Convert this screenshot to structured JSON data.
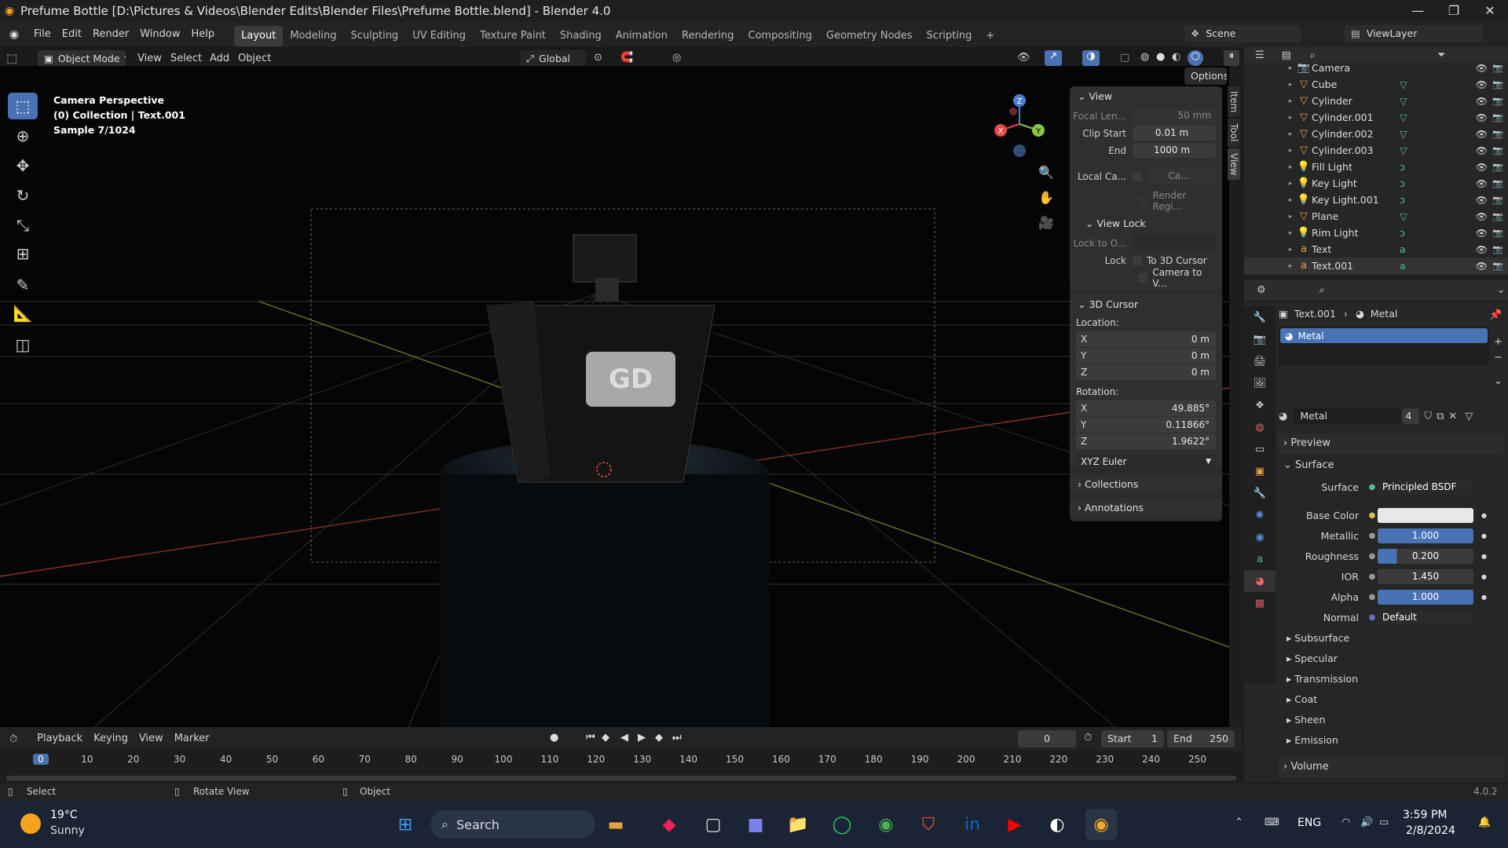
{
  "window": {
    "title": "Prefume Bottle [D:\\Pictures & Videos\\Blender Edits\\Blender Files\\Prefume Bottle.blend] - Blender 4.0",
    "minimize": "—",
    "maximize": "❐",
    "close": "✕"
  },
  "menubar": {
    "items": [
      "File",
      "Edit",
      "Render",
      "Window",
      "Help"
    ],
    "workspaces": [
      "Layout",
      "Modeling",
      "Sculpting",
      "UV Editing",
      "Texture Paint",
      "Shading",
      "Animation",
      "Rendering",
      "Compositing",
      "Geometry Nodes",
      "Scripting"
    ],
    "active_workspace": "Layout",
    "add_workspace": "+",
    "scene": "Scene",
    "view_layer": "ViewLayer"
  },
  "viewport_header": {
    "mode": "Object Mode",
    "menus": [
      "View",
      "Select",
      "Add",
      "Object"
    ],
    "orientation": "Global",
    "options": "Options"
  },
  "viewport": {
    "info_line1": "Camera Perspective",
    "info_line2": "(0) Collection | Text.001",
    "info_line3": "Sample 7/1024",
    "gizmo": {
      "x": "X",
      "y": "Y",
      "z": "Z"
    }
  },
  "npanel": {
    "tabs": [
      "Item",
      "Tool",
      "View"
    ],
    "view": {
      "title": "View",
      "focal_label": "Focal Len...",
      "focal_value": "50 mm",
      "clip_start_label": "Clip Start",
      "clip_start_value": "0.01 m",
      "end_label": "End",
      "end_value": "1000 m",
      "local_camera_label": "Local Ca...",
      "local_camera_value": "Ca...",
      "render_region": "Render Regi..."
    },
    "view_lock": {
      "title": "View Lock",
      "lock_to_label": "Lock to O...",
      "lock_label": "Lock",
      "to_3d_cursor": "To 3D Cursor",
      "camera_to_view": "Camera to V..."
    },
    "cursor": {
      "title": "3D Cursor",
      "location_label": "Location:",
      "loc_x": "0 m",
      "loc_y": "0 m",
      "loc_z": "0 m",
      "rotation_label": "Rotation:",
      "rot_x": "49.885°",
      "rot_y": "0.11866°",
      "rot_z": "1.9622°",
      "rotation_mode": "XYZ Euler"
    },
    "collections": "Collections",
    "annotations": "Annotations"
  },
  "outliner": {
    "items": [
      {
        "name": "Camera",
        "icon": "camera-icon"
      },
      {
        "name": "Cube",
        "icon": "mesh-icon"
      },
      {
        "name": "Cylinder",
        "icon": "mesh-icon"
      },
      {
        "name": "Cylinder.001",
        "icon": "mesh-icon"
      },
      {
        "name": "Cylinder.002",
        "icon": "mesh-icon"
      },
      {
        "name": "Cylinder.003",
        "icon": "mesh-icon"
      },
      {
        "name": "Fill Light",
        "icon": "light-icon"
      },
      {
        "name": "Key Light",
        "icon": "light-icon"
      },
      {
        "name": "Key Light.001",
        "icon": "light-icon"
      },
      {
        "name": "Plane",
        "icon": "mesh-icon"
      },
      {
        "name": "Rim Light",
        "icon": "light-icon"
      },
      {
        "name": "Text",
        "icon": "text-icon"
      },
      {
        "name": "Text.001",
        "icon": "text-icon"
      }
    ]
  },
  "properties": {
    "breadcrumb_object": "Text.001",
    "breadcrumb_material": "Metal",
    "slot_name": "Metal",
    "material_name": "Metal",
    "material_users": "4",
    "preview": "Preview",
    "surface_section": "Surface",
    "surface_label": "Surface",
    "surface_value": "Principled BSDF",
    "base_color_label": "Base Color",
    "metallic_label": "Metallic",
    "metallic_value": "1.000",
    "roughness_label": "Roughness",
    "roughness_value": "0.200",
    "roughness_fill": 0.2,
    "ior_label": "IOR",
    "ior_value": "1.450",
    "alpha_label": "Alpha",
    "alpha_value": "1.000",
    "normal_label": "Normal",
    "normal_value": "Default",
    "subsections": [
      "Subsurface",
      "Specular",
      "Transmission",
      "Coat",
      "Sheen",
      "Emission"
    ],
    "volume": "Volume"
  },
  "timeline": {
    "menus": [
      "Playback",
      "Keying",
      "View",
      "Marker"
    ],
    "current_frame": "0",
    "start_label": "Start",
    "start_value": "1",
    "end_label": "End",
    "end_value": "250",
    "ticks": [
      "0",
      "10",
      "20",
      "30",
      "40",
      "50",
      "60",
      "70",
      "80",
      "90",
      "100",
      "110",
      "120",
      "130",
      "140",
      "150",
      "160",
      "170",
      "180",
      "190",
      "200",
      "210",
      "220",
      "230",
      "240",
      "250"
    ]
  },
  "statusbar": {
    "select": "Select",
    "rotate_view": "Rotate View",
    "object": "Object",
    "version": "4.0.2"
  },
  "taskbar": {
    "weather_temp": "19°C",
    "weather_desc": "Sunny",
    "search": "Search",
    "language": "ENG",
    "time": "3:59 PM",
    "date": "2/8/2024"
  },
  "colors": {
    "accent": "#4a72b3",
    "slider_fill": "#4772b3",
    "x_axis": "#e34b4b",
    "y_axis": "#8bc34a",
    "z_axis": "#4a7fd6"
  }
}
